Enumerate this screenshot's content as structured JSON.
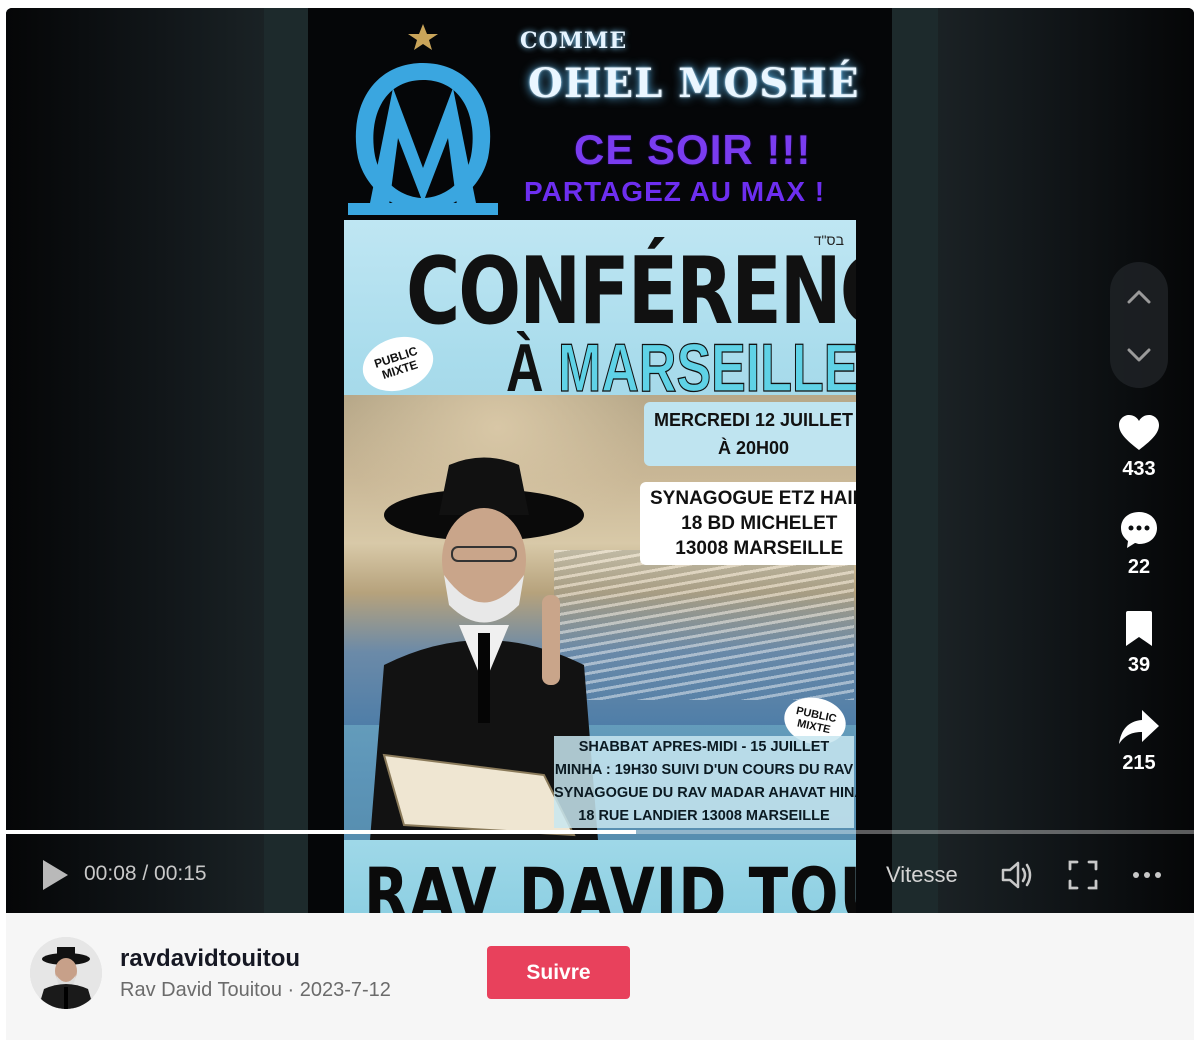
{
  "poster": {
    "comme": "COMME",
    "ohel": "OHEL MOSHÉ",
    "ce_soir": "CE SOIR !!!",
    "partagez": "PARTAGEZ AU MAX !",
    "bsd": "בס\"ד",
    "conference": "CONFÉRENCE",
    "a": "À",
    "marseille": "MARSEILLE",
    "public_1": "PUBLIC",
    "mixte_1": "MIXTE",
    "date_line1": "MERCREDI 12 JUILLET",
    "date_line2": "À 20H00",
    "place_line1": "SYNAGOGUE ETZ HAIM",
    "place_line2": "18 BD MICHELET",
    "place_line3": "13008 MARSEILLE",
    "public_2": "PUBLIC",
    "mixte_2": "MIXTE",
    "shabbat_line1": "SHABBAT APRES-MIDI - 15 JUILLET",
    "shabbat_line2": "MINHA : 19H30 SUIVI D'UN COURS DU RAV",
    "shabbat_line3": "SYNAGOGUE DU RAV MADAR AHAVAT HINAM",
    "shabbat_line4": "18 RUE LANDIER 13008 MARSEILLE",
    "rav_name": "RAV DAVID TOUITOU"
  },
  "actions": {
    "likes": "433",
    "comments": "22",
    "saves": "39",
    "shares": "215"
  },
  "player": {
    "time": "00:08 / 00:15",
    "speed_label": "Vitesse",
    "progress": 0.53
  },
  "footer": {
    "username": "ravdavidtouitou",
    "subline": "Rav David Touitou · 2023-7-12",
    "follow_label": "Suivre"
  },
  "colors": {
    "follow": "#e8415c",
    "om_blue": "#3aa6e0",
    "purple_text": "#7a3cf0",
    "marseille_cyan": "#5fd2e6"
  }
}
